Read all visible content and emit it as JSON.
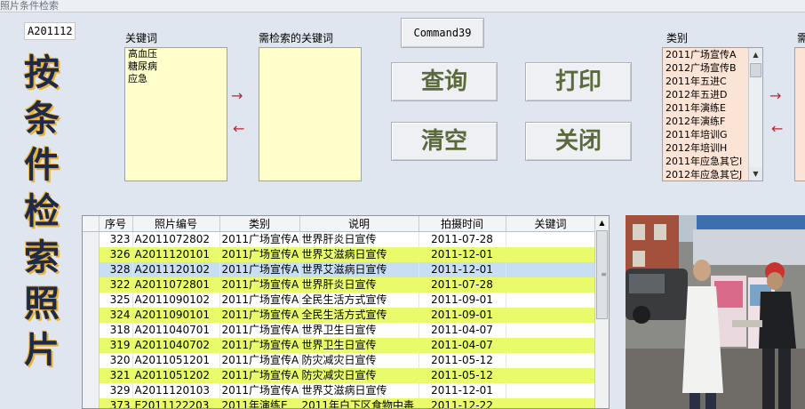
{
  "window": {
    "title": "照片条件检索"
  },
  "code_field": {
    "value": "A201112"
  },
  "big_title": [
    "按",
    "条",
    "件",
    "检",
    "索",
    "照",
    "片"
  ],
  "keywords": {
    "label": "关键词",
    "items": [
      "高血压",
      "糖尿病",
      "应急"
    ]
  },
  "search_keywords": {
    "label": "需检索的关键词",
    "items": []
  },
  "arrows": {
    "right": "→",
    "left": "←"
  },
  "buttons": {
    "command39": "Command39",
    "query": "查询",
    "print": "打印",
    "clear": "清空",
    "close": "关闭"
  },
  "category": {
    "label": "类别",
    "items": [
      "2011广场宣传A",
      "2012广场宣传B",
      "2011年五进C",
      "2012年五进D",
      "2011年演练E",
      "2012年演练F",
      "2011年培训G",
      "2012年培训H",
      "2011年应急其它I",
      "2012年应急其它J"
    ]
  },
  "search_category": {
    "label": "需"
  },
  "scroll_glyphs": {
    "up": "▲",
    "down": "▼",
    "grip": "≡"
  },
  "grid": {
    "columns": [
      "序号",
      "照片编号",
      "类别",
      "说明",
      "拍摄时间",
      "关键词"
    ],
    "rows": [
      {
        "style": "white",
        "cells": [
          "323",
          "A2011072802",
          "2011广场宣传A",
          "世界肝炎日宣传",
          "2011-07-28",
          ""
        ]
      },
      {
        "style": "yellow",
        "cells": [
          "326",
          "A2011120101",
          "2011广场宣传A",
          "世界艾滋病日宣传",
          "2011-12-01",
          ""
        ]
      },
      {
        "style": "blue",
        "cells": [
          "328",
          "A2011120102",
          "2011广场宣传A",
          "世界艾滋病日宣传",
          "2011-12-01",
          ""
        ]
      },
      {
        "style": "yellow",
        "cells": [
          "322",
          "A2011072801",
          "2011广场宣传A",
          "世界肝炎日宣传",
          "2011-07-28",
          ""
        ]
      },
      {
        "style": "white",
        "cells": [
          "325",
          "A2011090102",
          "2011广场宣传A",
          "全民生活方式宣传",
          "2011-09-01",
          ""
        ]
      },
      {
        "style": "yellow",
        "cells": [
          "324",
          "A2011090101",
          "2011广场宣传A",
          "全民生活方式宣传",
          "2011-09-01",
          ""
        ]
      },
      {
        "style": "white",
        "cells": [
          "318",
          "A2011040701",
          "2011广场宣传A",
          "世界卫生日宣传",
          "2011-04-07",
          ""
        ]
      },
      {
        "style": "yellow",
        "cells": [
          "319",
          "A2011040702",
          "2011广场宣传A",
          "世界卫生日宣传",
          "2011-04-07",
          ""
        ]
      },
      {
        "style": "white",
        "cells": [
          "320",
          "A2011051201",
          "2011广场宣传A",
          "防灾减灾日宣传",
          "2011-05-12",
          ""
        ]
      },
      {
        "style": "yellow",
        "cells": [
          "321",
          "A2011051202",
          "2011广场宣传A",
          "防灾减灾日宣传",
          "2011-05-12",
          ""
        ]
      },
      {
        "style": "white",
        "cells": [
          "329",
          "A2011120103",
          "2011广场宣传A",
          "世界艾滋病日宣传",
          "2011-12-01",
          ""
        ]
      },
      {
        "style": "yellow",
        "cells": [
          "373",
          "E2011122203",
          "2011年演练E",
          "2011年白下区食物中毒",
          "2011-12-22",
          ""
        ]
      }
    ]
  }
}
